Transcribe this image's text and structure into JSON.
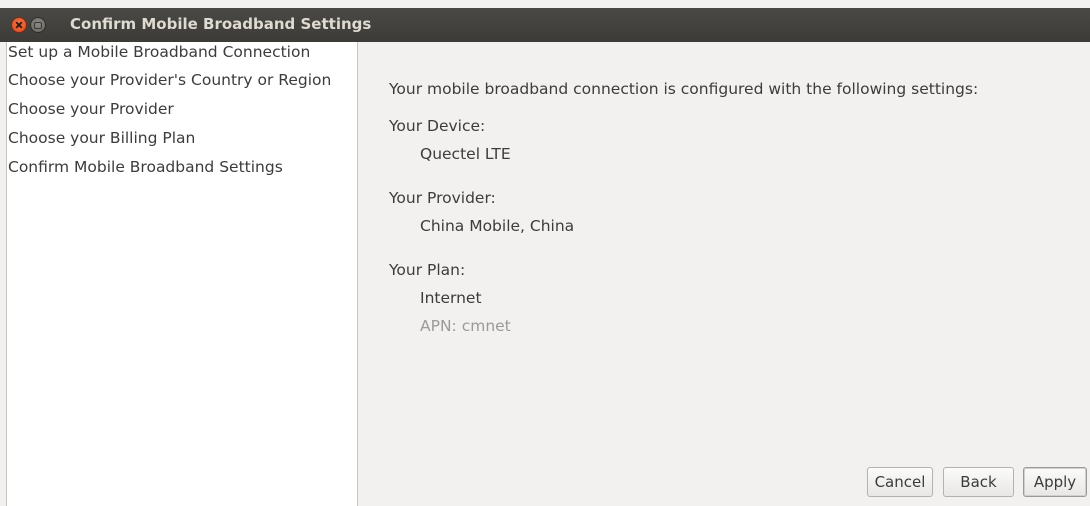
{
  "window": {
    "title": "Confirm Mobile Broadband Settings"
  },
  "sidebar": {
    "items": [
      {
        "label": "Set up a Mobile Broadband Connection"
      },
      {
        "label": "Choose your Provider's Country or Region"
      },
      {
        "label": "Choose your Provider"
      },
      {
        "label": "Choose your Billing Plan"
      },
      {
        "label": "Confirm Mobile Broadband Settings"
      }
    ]
  },
  "summary": {
    "intro": "Your mobile broadband connection is configured with the following settings:",
    "device_label": "Your Device:",
    "device_value": "Quectel LTE",
    "provider_label": "Your Provider:",
    "provider_value": "China Mobile, China",
    "plan_label": "Your Plan:",
    "plan_value": "Internet",
    "apn": "APN: cmnet"
  },
  "buttons": {
    "cancel": "Cancel",
    "back": "Back",
    "apply": "Apply"
  }
}
